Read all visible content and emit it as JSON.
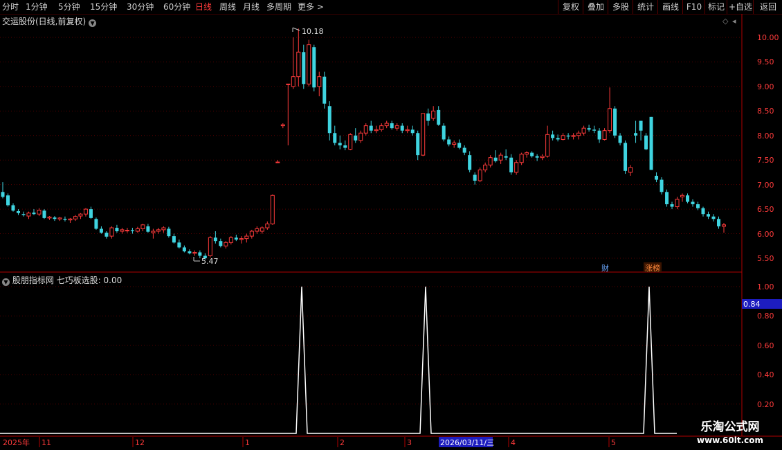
{
  "toolbar": {
    "periods": [
      {
        "label": "分时",
        "active": false
      },
      {
        "label": "1分钟",
        "active": false
      },
      {
        "label": "5分钟",
        "active": false
      },
      {
        "label": "15分钟",
        "active": false
      },
      {
        "label": "30分钟",
        "active": false
      },
      {
        "label": "60分钟",
        "active": false
      },
      {
        "label": "日线",
        "active": true
      },
      {
        "label": "周线",
        "active": false
      },
      {
        "label": "月线",
        "active": false
      },
      {
        "label": "多周期",
        "active": false
      },
      {
        "label": "更多 >",
        "active": false
      }
    ],
    "actions": [
      "复权",
      "叠加",
      "多股",
      "统计",
      "画线",
      "F10",
      "标记",
      "+自选",
      "返回"
    ]
  },
  "price_panel": {
    "title": "交运股份(日线,前复权)",
    "high_label": "10.18",
    "low_label": "5.47",
    "y_ticks": [
      "10.00",
      "9.50",
      "9.00",
      "8.50",
      "8.00",
      "7.50",
      "7.00",
      "6.50",
      "6.00",
      "5.50"
    ],
    "badges": [
      {
        "label": "财",
        "color": "#6aa8ff"
      },
      {
        "label": "涨榜",
        "color": "#ff8a3d"
      }
    ]
  },
  "indicator_panel": {
    "title": "股朋指标网 七巧板选股: 0.00",
    "y_ticks": [
      "1.00",
      "0.80",
      "0.60",
      "0.40",
      "0.20"
    ],
    "cursor_value": "0.84"
  },
  "x_axis": {
    "labels": [
      "2025年",
      "11",
      "12",
      "1",
      "2",
      "3",
      "4",
      "5"
    ],
    "cursor_date": "2026/03/11/三"
  },
  "watermark": {
    "line1": "乐淘公式网",
    "line2": "www.60lt.com"
  },
  "colors": {
    "up": "#ff3b3b",
    "down": "#3fd4e0",
    "grid": "#5a0000",
    "axis": "#b00000",
    "bg": "#000000",
    "line": "#ffffff"
  },
  "chart_data": {
    "type": "candlestick",
    "price_range": [
      5.3,
      10.3
    ],
    "candles": [
      [
        6.85,
        7.05,
        6.72,
        6.75
      ],
      [
        6.78,
        6.82,
        6.55,
        6.58
      ],
      [
        6.58,
        6.62,
        6.45,
        6.47
      ],
      [
        6.46,
        6.5,
        6.38,
        6.42
      ],
      [
        6.4,
        6.45,
        6.35,
        6.38
      ],
      [
        6.36,
        6.45,
        6.3,
        6.42
      ],
      [
        6.43,
        6.5,
        6.38,
        6.4
      ],
      [
        6.4,
        6.52,
        6.36,
        6.48
      ],
      [
        6.47,
        6.5,
        6.3,
        6.32
      ],
      [
        6.32,
        6.36,
        6.28,
        6.34
      ],
      [
        6.33,
        6.36,
        6.26,
        6.3
      ],
      [
        6.3,
        6.34,
        6.26,
        6.32
      ],
      [
        6.3,
        6.35,
        6.25,
        6.28
      ],
      [
        6.28,
        6.32,
        6.22,
        6.3
      ],
      [
        6.3,
        6.38,
        6.26,
        6.35
      ],
      [
        6.36,
        6.42,
        6.3,
        6.4
      ],
      [
        6.4,
        6.52,
        6.35,
        6.5
      ],
      [
        6.5,
        6.55,
        6.3,
        6.32
      ],
      [
        6.3,
        6.33,
        6.08,
        6.1
      ],
      [
        6.1,
        6.15,
        6.0,
        6.02
      ],
      [
        6.02,
        6.05,
        5.9,
        5.94
      ],
      [
        5.95,
        6.15,
        5.9,
        6.12
      ],
      [
        6.12,
        6.18,
        6.02,
        6.05
      ],
      [
        6.05,
        6.12,
        6.0,
        6.08
      ],
      [
        6.06,
        6.12,
        6.02,
        6.07
      ],
      [
        6.07,
        6.12,
        6.0,
        6.05
      ],
      [
        6.05,
        6.14,
        6.02,
        6.1
      ],
      [
        6.1,
        6.2,
        6.05,
        6.18
      ],
      [
        6.15,
        6.2,
        6.02,
        6.04
      ],
      [
        6.02,
        6.1,
        5.9,
        6.05
      ],
      [
        6.05,
        6.12,
        6.0,
        6.08
      ],
      [
        6.08,
        6.15,
        6.02,
        6.12
      ],
      [
        6.1,
        6.14,
        5.92,
        5.95
      ],
      [
        5.95,
        6.0,
        5.8,
        5.82
      ],
      [
        5.82,
        5.88,
        5.7,
        5.72
      ],
      [
        5.72,
        5.76,
        5.62,
        5.64
      ],
      [
        5.64,
        5.68,
        5.58,
        5.6
      ],
      [
        5.6,
        5.66,
        5.55,
        5.62
      ],
      [
        5.62,
        5.66,
        5.5,
        5.55
      ],
      [
        5.55,
        5.6,
        5.47,
        5.5
      ],
      [
        5.55,
        5.95,
        5.52,
        5.92
      ],
      [
        5.92,
        6.05,
        5.8,
        5.85
      ],
      [
        5.85,
        5.9,
        5.72,
        5.75
      ],
      [
        5.75,
        5.85,
        5.7,
        5.82
      ],
      [
        5.82,
        5.95,
        5.78,
        5.92
      ],
      [
        5.92,
        5.98,
        5.85,
        5.88
      ],
      [
        5.88,
        5.95,
        5.8,
        5.9
      ],
      [
        5.9,
        6.0,
        5.82,
        5.95
      ],
      [
        5.95,
        6.08,
        5.9,
        6.05
      ],
      [
        6.05,
        6.15,
        6.0,
        6.1
      ],
      [
        6.05,
        6.15,
        6.0,
        6.12
      ],
      [
        6.12,
        6.25,
        6.08,
        6.2
      ],
      [
        6.2,
        6.8,
        6.18,
        6.78
      ],
      [
        7.45,
        7.5,
        7.44,
        7.46
      ],
      [
        8.2,
        8.25,
        8.15,
        8.22
      ],
      [
        9.05,
        9.05,
        7.8,
        9.05
      ],
      [
        9.0,
        10.0,
        8.95,
        9.2
      ],
      [
        9.2,
        10.18,
        9.0,
        9.7
      ],
      [
        9.7,
        9.85,
        8.95,
        9.05
      ],
      [
        9.05,
        9.95,
        9.0,
        9.85
      ],
      [
        9.8,
        9.85,
        8.9,
        8.98
      ],
      [
        9.0,
        9.3,
        8.8,
        9.2
      ],
      [
        9.2,
        9.3,
        8.55,
        8.65
      ],
      [
        8.6,
        8.7,
        7.9,
        8.05
      ],
      [
        8.05,
        8.2,
        7.8,
        7.85
      ],
      [
        7.85,
        8.0,
        7.72,
        7.8
      ],
      [
        7.8,
        7.9,
        7.7,
        7.75
      ],
      [
        7.72,
        8.05,
        7.7,
        8.02
      ],
      [
        8.0,
        8.15,
        7.85,
        7.9
      ],
      [
        7.9,
        8.1,
        7.85,
        8.05
      ],
      [
        8.05,
        8.25,
        8.0,
        8.2
      ],
      [
        8.2,
        8.3,
        8.05,
        8.1
      ],
      [
        8.1,
        8.2,
        8.05,
        8.12
      ],
      [
        8.12,
        8.25,
        8.08,
        8.2
      ],
      [
        8.2,
        8.3,
        8.15,
        8.25
      ],
      [
        8.25,
        8.3,
        8.12,
        8.15
      ],
      [
        8.15,
        8.25,
        8.1,
        8.2
      ],
      [
        8.2,
        8.25,
        8.05,
        8.1
      ],
      [
        8.1,
        8.2,
        8.05,
        8.12
      ],
      [
        8.12,
        8.2,
        8.0,
        8.05
      ],
      [
        8.05,
        8.1,
        7.5,
        7.6
      ],
      [
        7.6,
        8.45,
        7.58,
        8.45
      ],
      [
        8.45,
        8.55,
        8.2,
        8.3
      ],
      [
        8.35,
        8.6,
        8.3,
        8.5
      ],
      [
        8.52,
        8.6,
        8.2,
        8.22
      ],
      [
        8.2,
        8.25,
        7.88,
        7.92
      ],
      [
        7.92,
        7.98,
        7.78,
        7.82
      ],
      [
        7.82,
        7.9,
        7.75,
        7.85
      ],
      [
        7.85,
        7.92,
        7.72,
        7.75
      ],
      [
        7.75,
        7.8,
        7.6,
        7.65
      ],
      [
        7.6,
        7.68,
        7.25,
        7.3
      ],
      [
        7.2,
        7.25,
        7.0,
        7.08
      ],
      [
        7.08,
        7.35,
        7.05,
        7.3
      ],
      [
        7.3,
        7.45,
        7.25,
        7.4
      ],
      [
        7.4,
        7.6,
        7.35,
        7.55
      ],
      [
        7.55,
        7.7,
        7.45,
        7.48
      ],
      [
        7.5,
        7.65,
        7.42,
        7.6
      ],
      [
        7.58,
        7.72,
        7.5,
        7.55
      ],
      [
        7.55,
        7.62,
        7.2,
        7.25
      ],
      [
        7.25,
        7.5,
        7.2,
        7.45
      ],
      [
        7.45,
        7.65,
        7.4,
        7.62
      ],
      [
        7.62,
        7.68,
        7.55,
        7.65
      ],
      [
        7.65,
        7.68,
        7.55,
        7.58
      ],
      [
        7.58,
        7.62,
        7.48,
        7.55
      ],
      [
        7.55,
        7.62,
        7.5,
        7.58
      ],
      [
        7.58,
        8.2,
        7.55,
        8.02
      ],
      [
        8.02,
        8.1,
        7.9,
        7.95
      ],
      [
        7.95,
        8.02,
        7.88,
        7.92
      ],
      [
        7.92,
        8.05,
        7.9,
        8.0
      ],
      [
        8.0,
        8.05,
        7.92,
        7.98
      ],
      [
        7.98,
        8.05,
        7.92,
        8.0
      ],
      [
        8.0,
        8.1,
        7.92,
        8.05
      ],
      [
        8.05,
        8.2,
        8.0,
        8.15
      ],
      [
        8.15,
        8.22,
        8.08,
        8.12
      ],
      [
        8.12,
        8.2,
        8.05,
        8.1
      ],
      [
        8.1,
        8.15,
        7.85,
        7.92
      ],
      [
        7.92,
        8.15,
        7.9,
        8.1
      ],
      [
        8.1,
        8.98,
        8.05,
        8.55
      ],
      [
        8.55,
        8.6,
        7.95,
        8.0
      ],
      [
        8.0,
        8.05,
        7.8,
        7.85
      ],
      [
        7.85,
        7.9,
        7.22,
        7.28
      ],
      [
        7.25,
        7.4,
        7.18,
        7.35
      ],
      [
        8.05,
        8.3,
        7.85,
        8.0
      ],
      [
        8.3,
        8.3,
        7.9,
        8.1
      ],
      [
        8.0,
        8.05,
        7.7,
        7.72
      ],
      [
        8.38,
        8.38,
        7.3,
        7.3
      ],
      [
        7.18,
        7.25,
        7.05,
        7.1
      ],
      [
        7.1,
        7.15,
        6.8,
        6.85
      ],
      [
        6.85,
        6.9,
        6.55,
        6.6
      ],
      [
        6.6,
        6.65,
        6.5,
        6.55
      ],
      [
        6.55,
        6.75,
        6.5,
        6.7
      ],
      [
        6.75,
        6.82,
        6.65,
        6.78
      ],
      [
        6.78,
        6.82,
        6.62,
        6.65
      ],
      [
        6.65,
        6.7,
        6.55,
        6.6
      ],
      [
        6.6,
        6.65,
        6.48,
        6.52
      ],
      [
        6.52,
        6.55,
        6.35,
        6.4
      ],
      [
        6.4,
        6.45,
        6.3,
        6.35
      ],
      [
        6.35,
        6.4,
        6.25,
        6.3
      ],
      [
        6.3,
        6.35,
        6.1,
        6.15
      ],
      [
        6.15,
        6.22,
        6.02,
        6.18
      ]
    ],
    "indicator": {
      "name": "七巧板选股",
      "value": 0.0,
      "signal_dates": [
        "2026-01",
        "2026-03",
        "2026-05"
      ],
      "signal_indices": [
        55,
        80,
        128
      ],
      "y_range": [
        0,
        1.0
      ]
    }
  }
}
